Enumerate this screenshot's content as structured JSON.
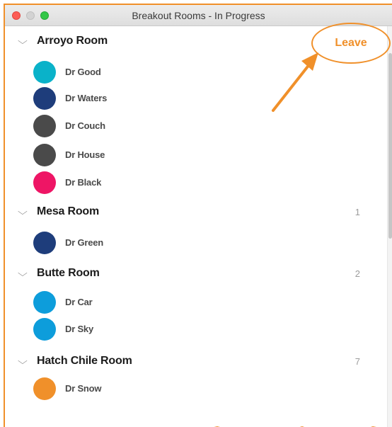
{
  "window": {
    "title": "Breakout Rooms - In Progress"
  },
  "rooms": [
    {
      "name": "Arroyo Room",
      "count": "",
      "members": [
        {
          "name": "Dr Good",
          "color": "#0ab2c9"
        },
        {
          "name": "Dr Waters",
          "color": "#1e3d7b"
        },
        {
          "name": "Dr Couch",
          "color": "#4a4a4a"
        },
        {
          "name": "Dr House",
          "color": "#4a4a4a"
        },
        {
          "name": "Dr Black",
          "color": "#ee1565"
        }
      ]
    },
    {
      "name": "Mesa Room",
      "count": "1",
      "members": [
        {
          "name": "Dr Green",
          "color": "#1e3d7b"
        }
      ]
    },
    {
      "name": "Butte Room",
      "count": "2",
      "members": [
        {
          "name": "Dr Car",
          "color": "#0d9ddb"
        },
        {
          "name": "Dr Sky",
          "color": "#0d9ddb"
        }
      ]
    },
    {
      "name": "Hatch Chile Room",
      "count": "7",
      "members": [
        {
          "name": "Dr Snow",
          "color": "#f0902a"
        }
      ]
    }
  ],
  "leave_button": {
    "label": "Leave"
  },
  "colors": {
    "accent": "#f0902a"
  },
  "icons": {
    "chevron": "chevron-down-icon",
    "arrow": "arrow-annotation-icon"
  }
}
